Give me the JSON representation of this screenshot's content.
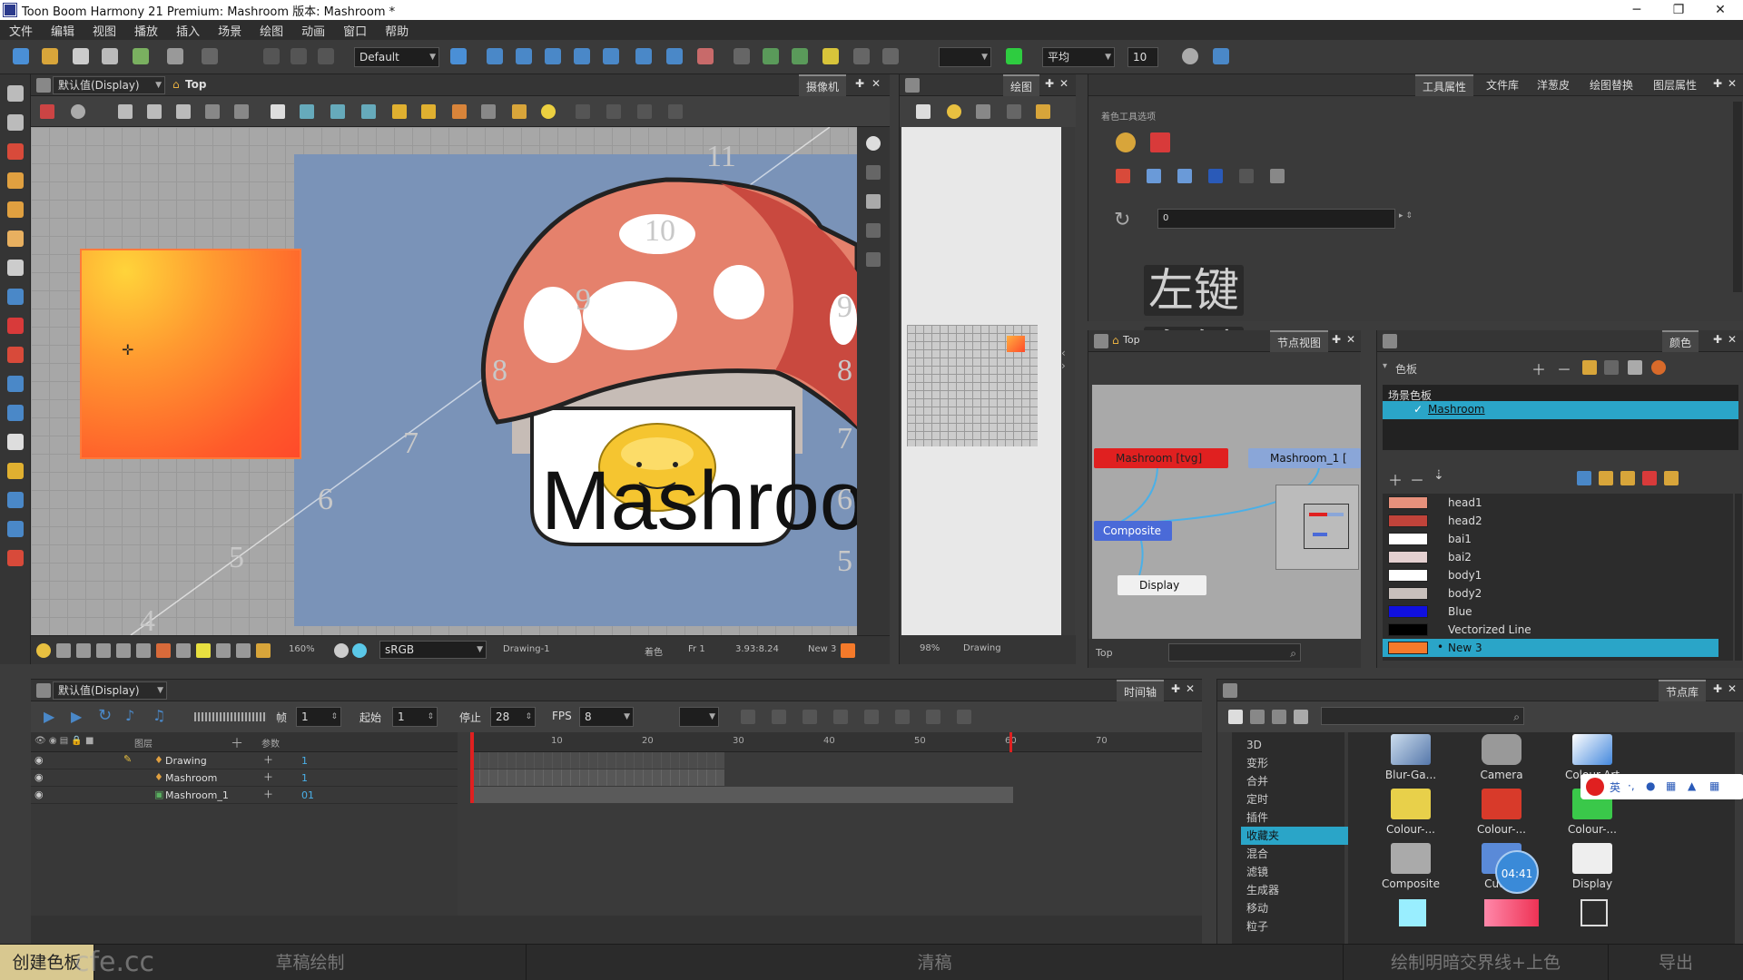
{
  "window": {
    "title": "Toon Boom Harmony 21 Premium: Mashroom 版本: Mashroom *"
  },
  "menu": [
    "文件",
    "编辑",
    "视图",
    "播放",
    "插入",
    "场景",
    "绘图",
    "动画",
    "窗口",
    "帮助"
  ],
  "toolbar": {
    "workspace": "Default",
    "smoothing": "平均",
    "smoothing_value": "10"
  },
  "camera_view": {
    "display_dropdown": "默认值(Display)",
    "breadcrumb": "Top",
    "tab": "摄像机",
    "title_text": "Mashroom",
    "zoom": "160%",
    "color_space": "sRGB",
    "status_drawing": "Drawing-1",
    "status_mode": "着色",
    "status_frame": "Fr 1",
    "status_coords": "3.93:8.24",
    "status_palette": "New 3",
    "ruler": [
      "11",
      "10",
      "9",
      "8",
      "7",
      "6",
      "5",
      "4"
    ],
    "ruler_right": [
      "9",
      "8",
      "7",
      "6",
      "5"
    ]
  },
  "drawing_view": {
    "tab": "绘图",
    "zoom": "98%",
    "status": "Drawing"
  },
  "tool_properties": {
    "tabs": [
      "工具属性",
      "文件库",
      "洋葱皮",
      "绘图替换",
      "图层属性"
    ],
    "section_label": "着色工具选项",
    "field_value": "0"
  },
  "overlay_keys": [
    "左键",
    "左键",
    "左键"
  ],
  "node_view": {
    "breadcrumb": "Top",
    "tab": "节点视图",
    "nodes": [
      "Mashroom [tvg]",
      "Mashroom_1 [",
      "Composite",
      "Display"
    ],
    "footer": "Top"
  },
  "colour_panel": {
    "tab": "颜色",
    "palette_list_label": "色板",
    "scene_palette_label": "场景色板",
    "palette_name": "Mashroom",
    "swatches": [
      {
        "name": "head1",
        "color": "#e7917c"
      },
      {
        "name": "head2",
        "color": "#c0433a"
      },
      {
        "name": "bai1",
        "color": "#ffffff"
      },
      {
        "name": "bai2",
        "color": "#e4d0d0"
      },
      {
        "name": "body1",
        "color": "#ffffff"
      },
      {
        "name": "body2",
        "color": "#c8c0bc"
      },
      {
        "name": "Blue",
        "color": "#1010e0"
      },
      {
        "name": "Vectorized Line",
        "color": "#000000"
      },
      {
        "name": "New 3",
        "color": "#f57a2a"
      }
    ]
  },
  "timeline": {
    "display_dropdown": "默认值(Display)",
    "tab": "时间轴",
    "frame_label": "帧",
    "frame_value": "1",
    "start_label": "起始",
    "start_value": "1",
    "stop_label": "停止",
    "stop_value": "28",
    "fps_label": "FPS",
    "fps_value": "8",
    "header_layer": "图层",
    "header_params": "参数",
    "layers": [
      {
        "name": "Drawing",
        "value": "1"
      },
      {
        "name": "Mashroom",
        "value": "1"
      },
      {
        "name": "Mashroom_1",
        "value": "01"
      }
    ],
    "ruler": [
      "10",
      "20",
      "30",
      "40",
      "50",
      "60",
      "70"
    ]
  },
  "node_library": {
    "tab": "节点库",
    "categories": [
      "3D",
      "变形",
      "合并",
      "定时",
      "插件",
      "收藏夹",
      "混合",
      "滤镜",
      "生成器",
      "移动",
      "粒子"
    ],
    "selected": "收藏夹",
    "items": [
      "Blur-Ga...",
      "Camera",
      "Colour-Art",
      "Colour-...",
      "Colour-...",
      "Colour-...",
      "Composite",
      "Cutter",
      "Display"
    ]
  },
  "clock": "04:41",
  "ime": "英",
  "watermark": "cfe.cc",
  "bottom_steps": [
    "创建色板",
    "草稿绘制",
    "清稿",
    "绘制明暗交界线+上色",
    "导出"
  ]
}
